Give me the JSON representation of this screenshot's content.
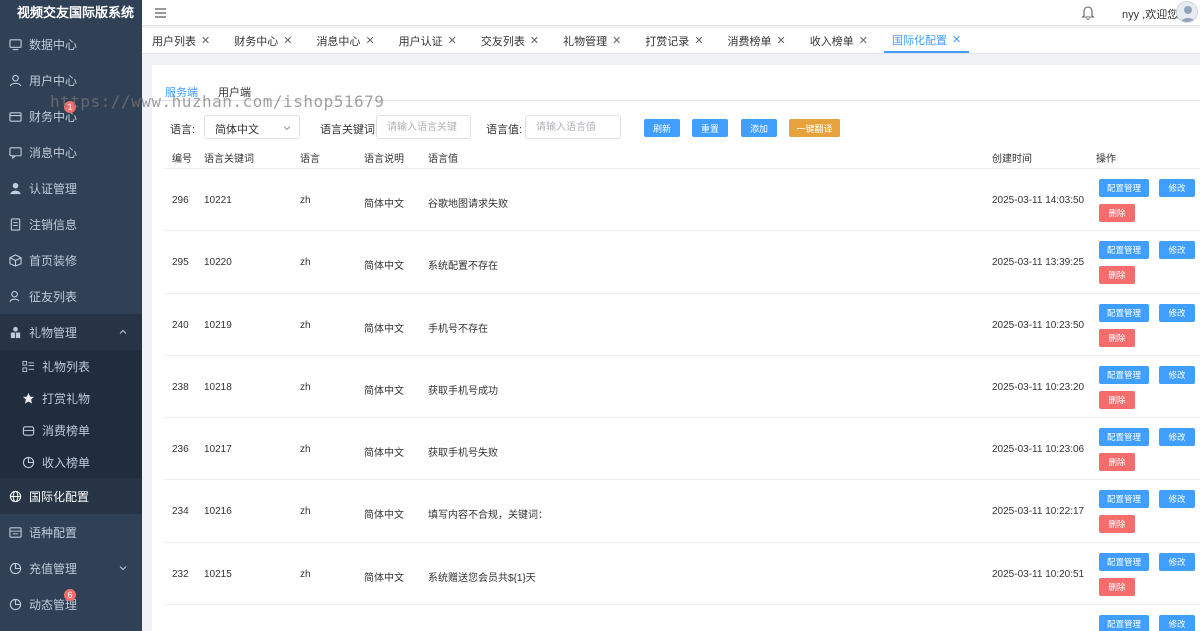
{
  "app": {
    "title": "视频交友国际版系统"
  },
  "sidebar": {
    "items": [
      {
        "label": "数据中心",
        "icon": "desktop-icon"
      },
      {
        "label": "用户中心",
        "icon": "user-icon"
      },
      {
        "label": "财务中心",
        "icon": "wallet-icon",
        "badge": "1"
      },
      {
        "label": "消息中心",
        "icon": "message-icon"
      },
      {
        "label": "认证管理",
        "icon": "person-icon"
      },
      {
        "label": "注销信息",
        "icon": "document-icon"
      },
      {
        "label": "首页装修",
        "icon": "box-icon"
      },
      {
        "label": "征友列表",
        "icon": "user-search-icon"
      },
      {
        "label": "礼物管理",
        "icon": "gift-person-icon"
      }
    ],
    "gift_sub": [
      {
        "label": "礼物列表",
        "icon": "list-icon"
      },
      {
        "label": "打赏礼物",
        "icon": "star-icon"
      },
      {
        "label": "消费榜单",
        "icon": "wallet-icon"
      },
      {
        "label": "收入榜单",
        "icon": "pie-icon"
      }
    ],
    "after": [
      {
        "label": "国际化配置",
        "icon": "globe-icon"
      },
      {
        "label": "语种配置",
        "icon": "table-icon"
      },
      {
        "label": "充值管理",
        "icon": "pie-icon"
      },
      {
        "label": "动态管理",
        "icon": "pie-icon",
        "badge": "6"
      }
    ]
  },
  "header": {
    "welcome": "nyy ,欢迎您"
  },
  "tabs": [
    {
      "label": "用户列表"
    },
    {
      "label": "财务中心"
    },
    {
      "label": "消息中心"
    },
    {
      "label": "用户认证"
    },
    {
      "label": "交友列表"
    },
    {
      "label": "礼物管理"
    },
    {
      "label": "打赏记录"
    },
    {
      "label": "消费榜单"
    },
    {
      "label": "收入榜单"
    },
    {
      "label": "国际化配置"
    }
  ],
  "subtabs": {
    "server": "服务端",
    "client": "用户端"
  },
  "watermark": "https://www.huzhan.com/ishop51679",
  "filter": {
    "lang_label": "语言:",
    "lang_value": "简体中文",
    "key_label": "语言关键词:",
    "key_placeholder": "请输入语言关键",
    "val_label": "语言值:",
    "val_placeholder": "请输入语言值",
    "btn_refresh": "刷新",
    "btn_reset": "重置",
    "btn_add": "添加",
    "btn_translate": "一键翻译"
  },
  "table": {
    "headers": [
      "编号",
      "语言关键词",
      "语言",
      "语言说明",
      "语言值",
      "创建时间",
      "操作"
    ],
    "actions": {
      "config": "配置管理",
      "edit": "修改",
      "delete": "删除"
    },
    "rows": [
      {
        "id": "296",
        "key": "10221",
        "lang": "zh",
        "desc": "简体中文",
        "value": "谷歌地图请求失败",
        "time": "2025-03-11 14:03:50"
      },
      {
        "id": "295",
        "key": "10220",
        "lang": "zh",
        "desc": "简体中文",
        "value": "系统配置不存在",
        "time": "2025-03-11 13:39:25"
      },
      {
        "id": "240",
        "key": "10219",
        "lang": "zh",
        "desc": "简体中文",
        "value": "手机号不存在",
        "time": "2025-03-11 10:23:50"
      },
      {
        "id": "238",
        "key": "10218",
        "lang": "zh",
        "desc": "简体中文",
        "value": "获取手机号成功",
        "time": "2025-03-11 10:23:20"
      },
      {
        "id": "236",
        "key": "10217",
        "lang": "zh",
        "desc": "简体中文",
        "value": "获取手机号失败",
        "time": "2025-03-11 10:23:06"
      },
      {
        "id": "234",
        "key": "10216",
        "lang": "zh",
        "desc": "简体中文",
        "value": "填写内容不合规，关键词：",
        "time": "2025-03-11 10:22:17"
      },
      {
        "id": "232",
        "key": "10215",
        "lang": "zh",
        "desc": "简体中文",
        "value": "系统赠送您会员共${1}天",
        "time": "2025-03-11 10:20:51"
      }
    ]
  }
}
